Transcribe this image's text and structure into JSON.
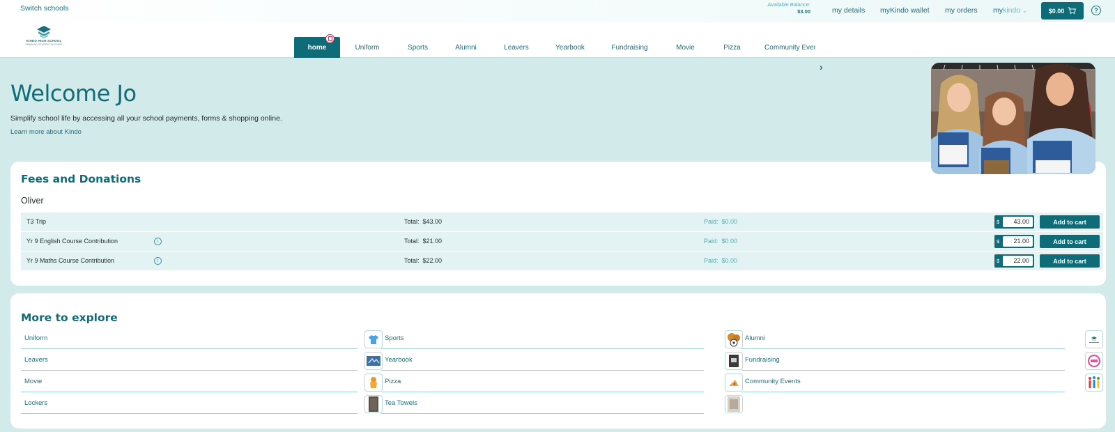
{
  "topbar": {
    "switch_schools": "Switch schools",
    "balance_label": "Available Balance:",
    "balance_value": "$3.00",
    "links": [
      "my details",
      "myKindo wallet",
      "my orders"
    ],
    "mykindo_a": "my",
    "mykindo_b": "kindo",
    "cart_amount": "$0.00",
    "help": "?"
  },
  "logo": {
    "line1": "KINDO HIGH SCHOOL",
    "line2": "ENABLING STUDENT SUCCESS"
  },
  "nav": {
    "tabs": [
      "home",
      "Uniform",
      "Sports",
      "Alumni",
      "Leavers",
      "Yearbook",
      "Fundraising",
      "Movie",
      "Pizza",
      "Community Events"
    ],
    "active": "home"
  },
  "hero": {
    "welcome": "Welcome Jo",
    "tagline": "Simplify school life by accessing all your school payments, forms & shopping online.",
    "learn_more": "Learn more about Kindo"
  },
  "fees": {
    "title": "Fees and Donations",
    "student": "Oliver",
    "total_label": "Total:",
    "paid_label": "Paid:",
    "currency": "$",
    "add_label": "Add to cart",
    "rows": [
      {
        "name": "T3 Trip",
        "total": "$43.00",
        "paid": "$0.00",
        "amount": "43.00",
        "info": false
      },
      {
        "name": "Yr 9 English Course Contribution",
        "total": "$21.00",
        "paid": "$0.00",
        "amount": "21.00",
        "info": true
      },
      {
        "name": "Yr 9 Maths Course Contribution",
        "total": "$22.00",
        "paid": "$0.00",
        "amount": "22.00",
        "info": true
      }
    ]
  },
  "explore": {
    "title": "More to explore",
    "columns": [
      [
        {
          "name": "Uniform",
          "icon": "tshirt-icon"
        },
        {
          "name": "Leavers",
          "icon": "leavers-icon"
        },
        {
          "name": "Movie",
          "icon": "movie-icon"
        },
        {
          "name": "Lockers",
          "icon": "locker-icon"
        }
      ],
      [
        {
          "name": "Sports",
          "icon": "sports-balls-icon"
        },
        {
          "name": "Yearbook",
          "icon": "yearbook-icon"
        },
        {
          "name": "Pizza",
          "icon": "pizza-icon"
        },
        {
          "name": "Tea Towels",
          "icon": "tea-towel-icon"
        }
      ],
      [
        {
          "name": "Alumni",
          "icon": "alumni-logo-icon"
        },
        {
          "name": "Fundraising",
          "icon": "fundraising-icon"
        },
        {
          "name": "Community Events",
          "icon": "community-icon"
        }
      ]
    ]
  },
  "colors": {
    "brand": "#0e6b78",
    "background": "#d3eaea",
    "badge": "#d12e5b"
  }
}
